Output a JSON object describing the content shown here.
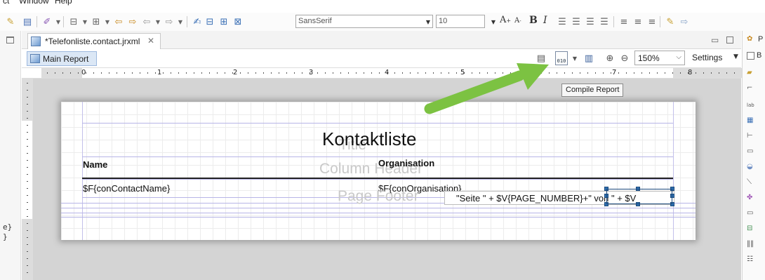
{
  "menu": {
    "partial_left": "ct",
    "window": "Window",
    "help": "Help"
  },
  "toolbar": {
    "font_name": "SansSerif",
    "font_size": "10",
    "grow_font": "A",
    "shrink_font": "A",
    "bold": "B",
    "italic": "I"
  },
  "editor_tab": {
    "label": "*Telefonliste.contact.jrxml",
    "close_glyph": "✕"
  },
  "report_toolbar": {
    "main_report_label": "Main Report",
    "zoom_value": "150%",
    "settings_label": "Settings",
    "compile_tooltip": "Compile Report"
  },
  "ruler": {
    "numbers": [
      "0",
      "1",
      "2",
      "3",
      "4",
      "5",
      "6",
      "7",
      "8"
    ]
  },
  "report": {
    "title": "Kontaktliste",
    "title_band_watermark": "Title",
    "column_header_watermark": "Column Header",
    "page_footer_watermark": "Page Footer",
    "col_name": "Name",
    "col_organisation": "Organisation",
    "field_name": "$F{conContactName}",
    "field_organisation": "$F{conOrganisation}",
    "footer_expression": "\"Seite \" + $V{PAGE_NUMBER}+\" von \" + $V"
  },
  "left_panel": {
    "line1": "e}",
    "line2": "}"
  },
  "right_panel": {
    "header_letter": "P",
    "checkbox_letter": "B"
  },
  "colors": {
    "arrow": "#7cc242",
    "selection": "#2f6fb0",
    "band_line": "#b7b4e6"
  }
}
